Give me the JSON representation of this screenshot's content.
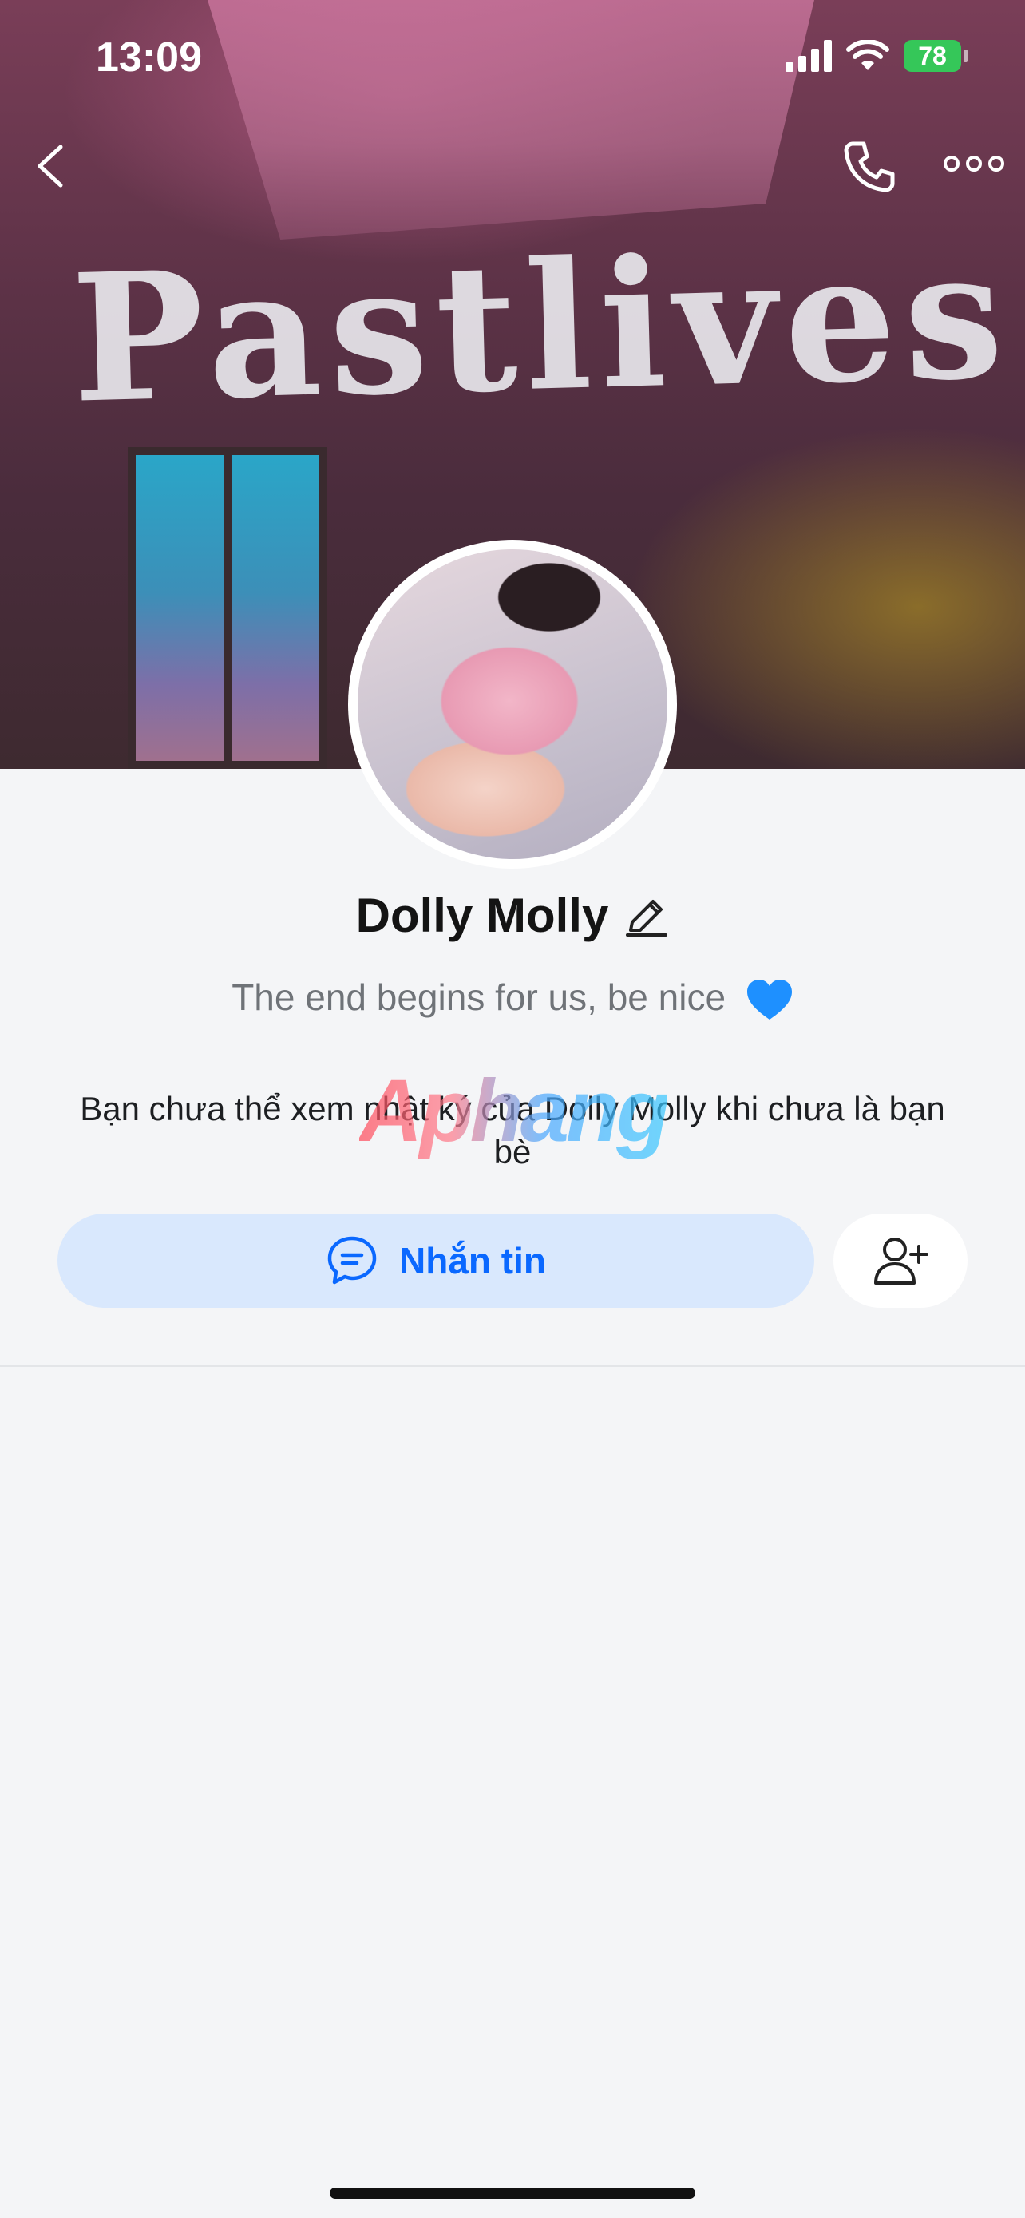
{
  "status_bar": {
    "time": "13:09",
    "battery": "78"
  },
  "cover": {
    "text": "Pastlives"
  },
  "profile": {
    "name": "Dolly Molly",
    "status_text": "The end begins for us, be nice",
    "notice": "Bạn chưa thể xem nhật ký của Dolly Molly khi chưa là bạn bè"
  },
  "actions": {
    "message_label": "Nhắn tin"
  },
  "watermark": "Aphang",
  "colors": {
    "accent": "#0a68ff",
    "message_bg": "#d9e8fd",
    "heart": "#1e90ff"
  },
  "icons": [
    "back-chevron-icon",
    "phone-icon",
    "more-icon",
    "edit-pencil-icon",
    "blue-heart-icon",
    "chat-bubble-icon",
    "add-friend-icon"
  ]
}
